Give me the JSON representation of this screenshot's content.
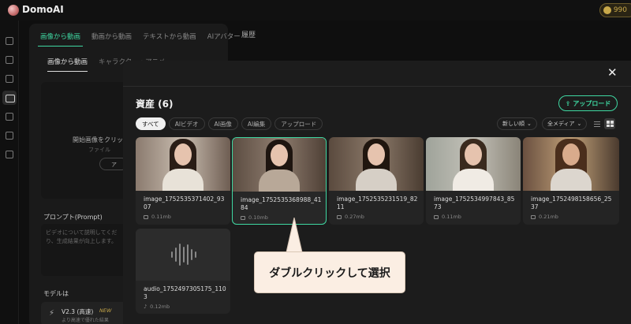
{
  "app": {
    "title": "DomoAI",
    "credits": "990"
  },
  "main_tabs": [
    {
      "label": "画像から動画"
    },
    {
      "label": "動画から動画"
    },
    {
      "label": "テキストから動画"
    },
    {
      "label": "AIアバター"
    }
  ],
  "history_label": "履歴",
  "sub_tabs": [
    {
      "label": "画像から動画"
    },
    {
      "label": "キャラクター・アニメ"
    }
  ],
  "upload_panel": {
    "text": "開始画像をクリック",
    "sub": "ファイル",
    "button": "ア"
  },
  "prompt": {
    "label": "プロンプト(Prompt)",
    "placeholder_line1": "ビデオについて説明してくだ",
    "placeholder_line2": "り、生成結果が向上します。"
  },
  "model": {
    "label": "モデルは",
    "name": "V2.3 (高速)",
    "badge": "NEW",
    "sub": "より高速で優れた結果"
  },
  "modal": {
    "title": "資産 (6)",
    "upload_button": "アップロード",
    "filters": [
      "すべて",
      "AIビデオ",
      "AI画像",
      "AI編集",
      "アップロード"
    ],
    "sort": "新しい順",
    "media": "全メディア"
  },
  "assets": [
    {
      "name": "image_1752535371402_9307",
      "size": "0.11mb"
    },
    {
      "name": "image_1752535368988_4184",
      "size": "0.10mb"
    },
    {
      "name": "image_1752535231519_8211",
      "size": "0.27mb"
    },
    {
      "name": "image_1752534997843_8573",
      "size": "0.11mb"
    },
    {
      "name": "image_1752498158656_2537",
      "size": "0.21mb"
    }
  ],
  "audio_asset": {
    "name": "audio_1752497305175_1103",
    "size": "0.12mb"
  },
  "callout": "ダブルクリックして選択",
  "colors": {
    "accent": "#3fd8a2",
    "modal_bg": "#1c1c1c",
    "callout_bg": "#fbeee3"
  }
}
